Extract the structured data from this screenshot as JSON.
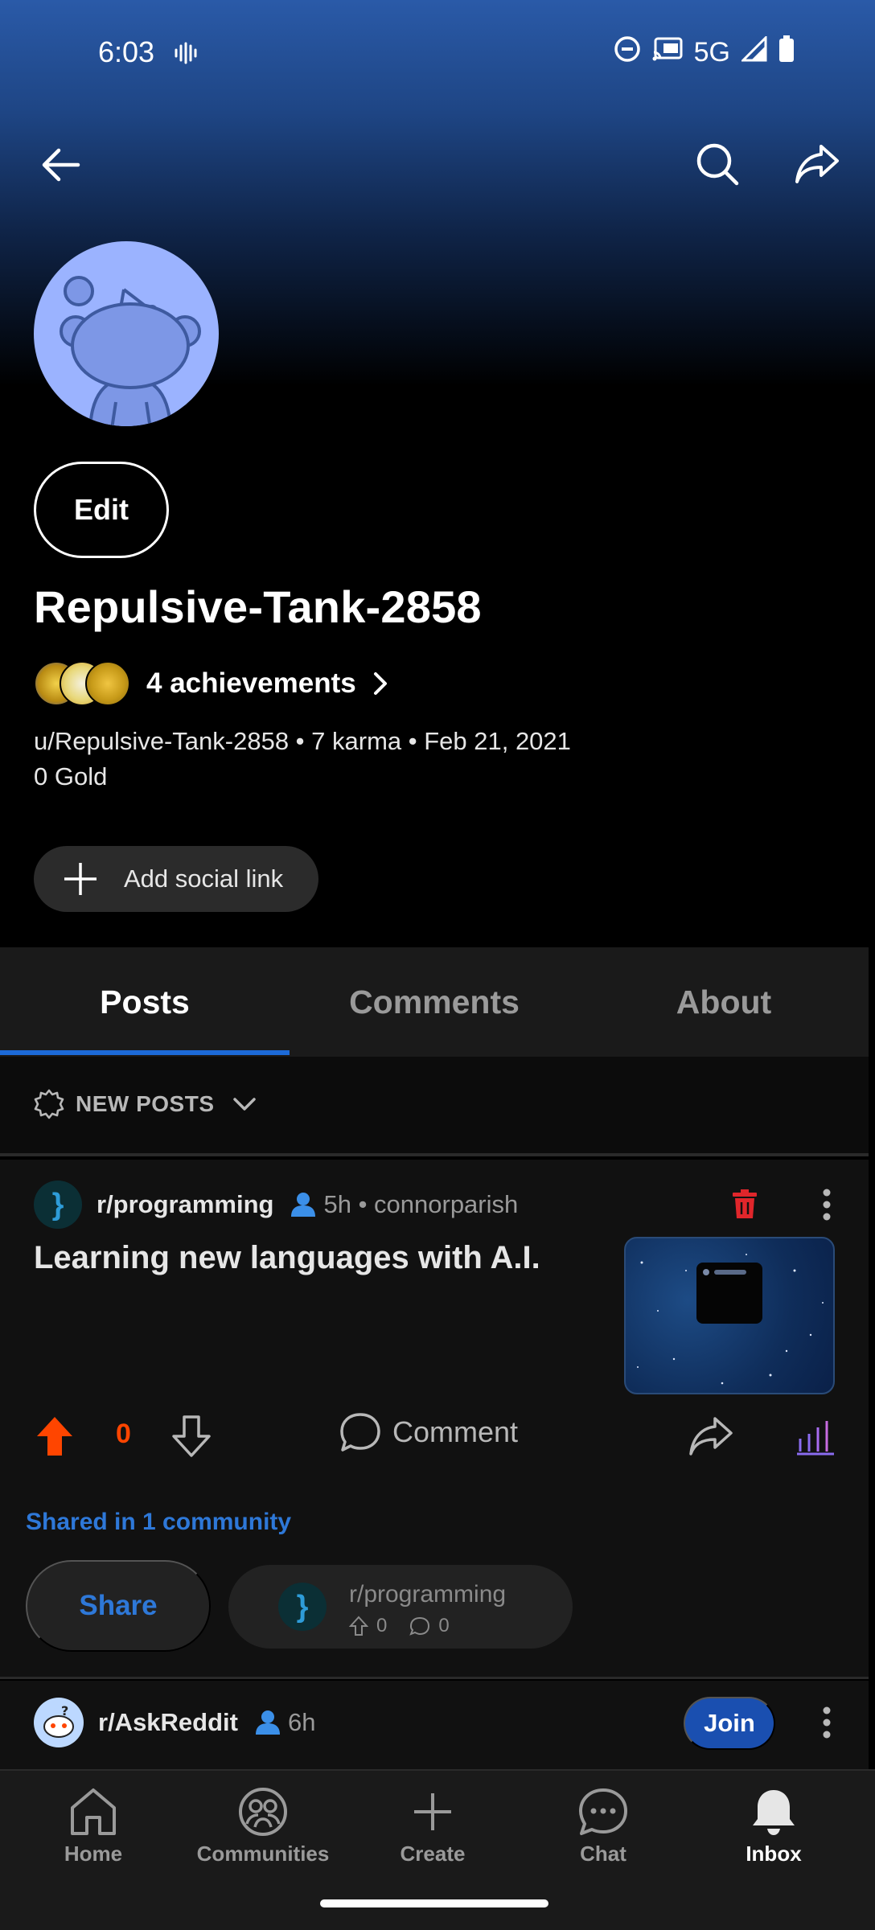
{
  "status_bar": {
    "time": "6:03",
    "network": "5G"
  },
  "profile": {
    "edit_label": "Edit",
    "username": "Repulsive-Tank-2858",
    "achievements_label": "4 achievements",
    "meta": "u/Repulsive-Tank-2858 • 7 karma • Feb 21, 2021",
    "gold": "0 Gold",
    "add_social_label": "Add social link"
  },
  "tabs": [
    {
      "label": "Posts",
      "active": true
    },
    {
      "label": "Comments",
      "active": false
    },
    {
      "label": "About",
      "active": false
    }
  ],
  "sort": {
    "label": "NEW POSTS"
  },
  "posts": [
    {
      "subreddit": "r/programming",
      "sub_icon": "}",
      "time_author": "5h • connorparish",
      "title": "Learning new languages with A.I.",
      "votes": "0",
      "comment_label": "Comment",
      "shared_in": "Shared in 1 community",
      "share_label": "Share",
      "crosspost": {
        "subreddit": "r/programming",
        "upvotes": "0",
        "comments": "0"
      }
    },
    {
      "subreddit": "r/AskReddit",
      "time": "6h",
      "join_label": "Join"
    }
  ],
  "bottom_nav": [
    {
      "label": "Home",
      "icon": "home-icon"
    },
    {
      "label": "Communities",
      "icon": "communities-icon"
    },
    {
      "label": "Create",
      "icon": "create-icon"
    },
    {
      "label": "Chat",
      "icon": "chat-icon"
    },
    {
      "label": "Inbox",
      "icon": "inbox-icon",
      "active": true
    }
  ],
  "colors": {
    "accent": "#1c6ad8",
    "upvote": "#ff4500",
    "join": "#1a4fb0",
    "delete": "#e0262b"
  }
}
